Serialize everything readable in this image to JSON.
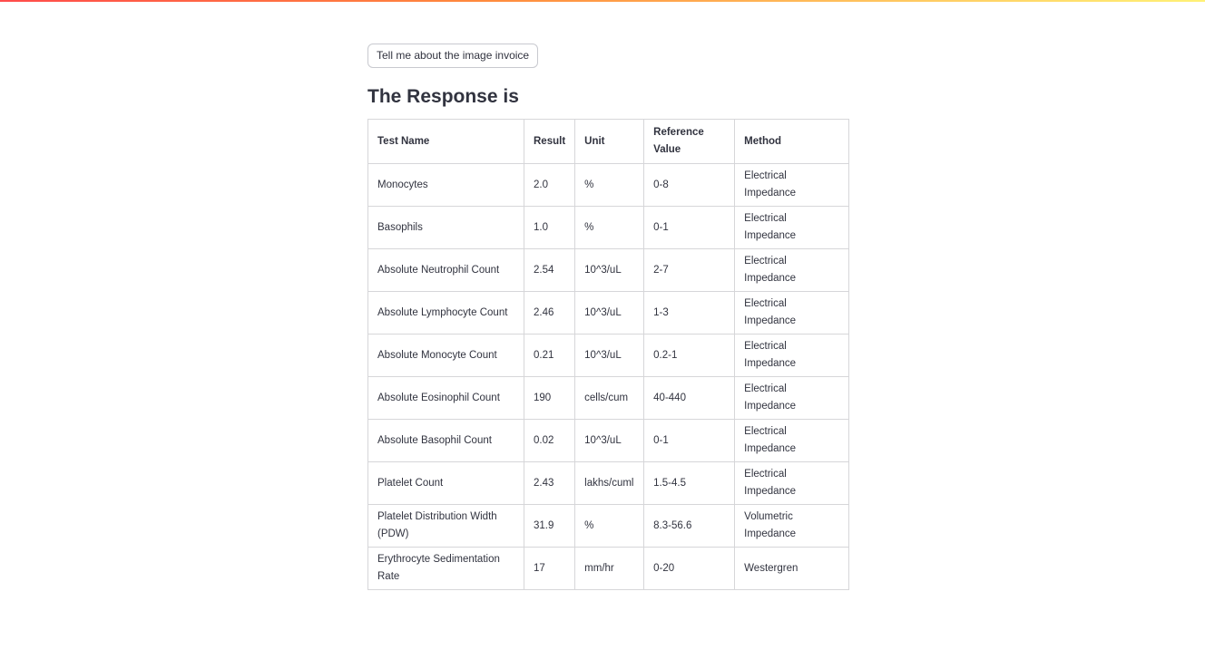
{
  "button": {
    "label": "Tell me about the image invoice"
  },
  "heading": "The Response is",
  "table": {
    "headers": [
      "Test Name",
      "Result",
      "Unit",
      "Reference Value",
      "Method"
    ],
    "rows": [
      [
        "Monocytes",
        "2.0",
        "%",
        "0-8",
        "Electrical Impedance"
      ],
      [
        "Basophils",
        "1.0",
        "%",
        "0-1",
        "Electrical Impedance"
      ],
      [
        "Absolute Neutrophil Count",
        "2.54",
        "10^3/uL",
        "2-7",
        "Electrical Impedance"
      ],
      [
        "Absolute Lymphocyte Count",
        "2.46",
        "10^3/uL",
        "1-3",
        "Electrical Impedance"
      ],
      [
        "Absolute Monocyte Count",
        "0.21",
        "10^3/uL",
        "0.2-1",
        "Electrical Impedance"
      ],
      [
        "Absolute Eosinophil Count",
        "190",
        "cells/cum",
        "40-440",
        "Electrical Impedance"
      ],
      [
        "Absolute Basophil Count",
        "0.02",
        "10^3/uL",
        "0-1",
        "Electrical Impedance"
      ],
      [
        "Platelet Count",
        "2.43",
        "lakhs/cuml",
        "1.5-4.5",
        "Electrical Impedance"
      ],
      [
        "Platelet Distribution Width (PDW)",
        "31.9",
        "%",
        "8.3-56.6",
        "Volumetric Impedance"
      ],
      [
        "Erythrocyte Sedimentation Rate",
        "17",
        "mm/hr",
        "0-20",
        "Westergren"
      ]
    ]
  }
}
